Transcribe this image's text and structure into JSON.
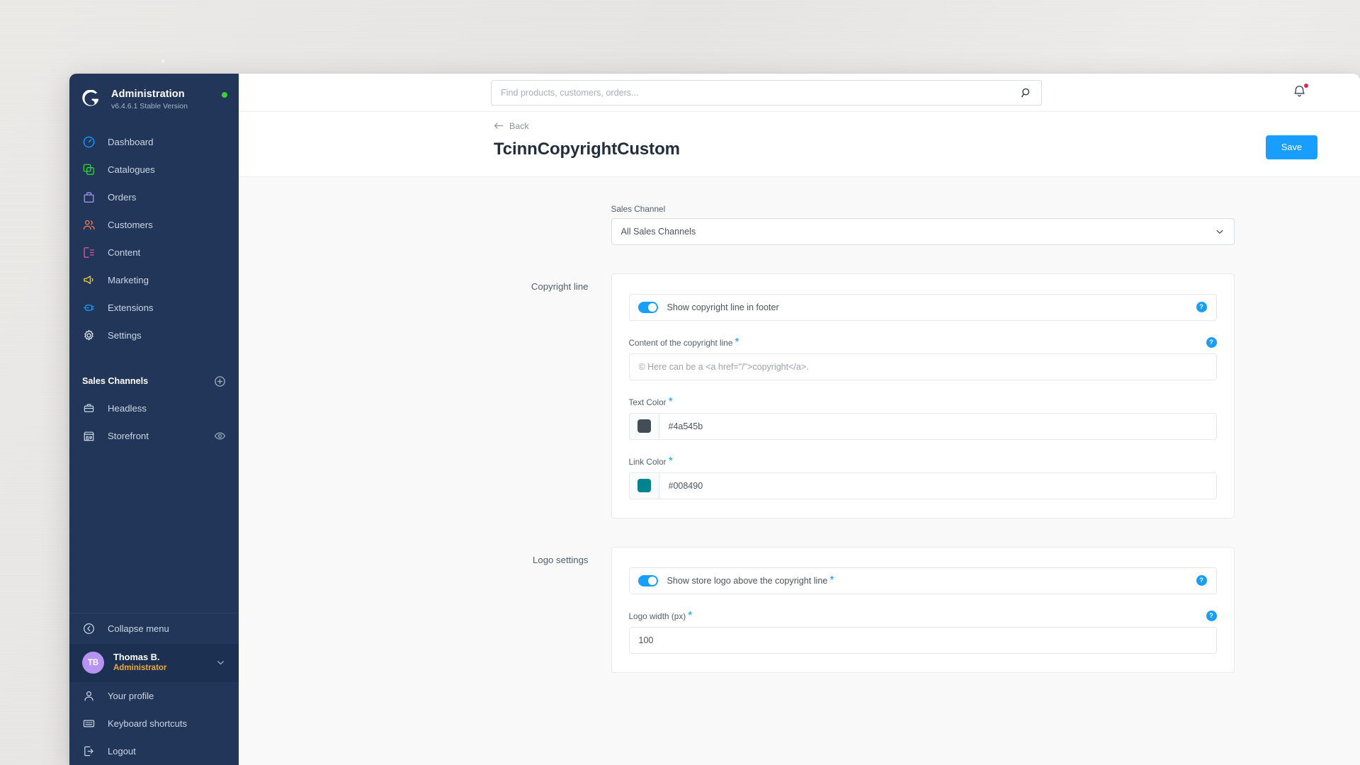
{
  "sidebar": {
    "brand": {
      "title": "Administration",
      "version": "v6.4.6.1 Stable Version",
      "logo_icon": "shopware-logo-icon",
      "status_icon": "status-online-dot"
    },
    "nav": [
      {
        "label": "Dashboard",
        "icon": "dashboard-icon",
        "color": "#189eff"
      },
      {
        "label": "Catalogues",
        "icon": "catalogues-icon",
        "color": "#37d039"
      },
      {
        "label": "Orders",
        "icon": "orders-icon",
        "color": "#a092f0"
      },
      {
        "label": "Customers",
        "icon": "customers-icon",
        "color": "#ee7b4f"
      },
      {
        "label": "Content",
        "icon": "content-icon",
        "color": "#e052a0"
      },
      {
        "label": "Marketing",
        "icon": "marketing-icon",
        "color": "#f0d124"
      },
      {
        "label": "Extensions",
        "icon": "extensions-icon",
        "color": "#189eff"
      },
      {
        "label": "Settings",
        "icon": "settings-gear-icon",
        "color": "#d8dde3"
      }
    ],
    "sales_channels": {
      "title": "Sales Channels",
      "add_icon": "plus-circle-icon",
      "items": [
        {
          "label": "Headless",
          "icon": "headless-icon"
        },
        {
          "label": "Storefront",
          "icon": "storefront-icon",
          "trailing_icon": "eye-icon"
        }
      ]
    },
    "collapse": {
      "label": "Collapse menu",
      "icon": "collapse-chevron-icon"
    },
    "user": {
      "initials": "TB",
      "name": "Thomas B.",
      "role": "Administrator",
      "chevron_icon": "chevron-down-icon"
    },
    "user_menu": [
      {
        "label": "Your profile",
        "icon": "user-icon"
      },
      {
        "label": "Keyboard shortcuts",
        "icon": "keyboard-icon"
      },
      {
        "label": "Logout",
        "icon": "logout-icon"
      }
    ]
  },
  "topbar": {
    "search": {
      "placeholder": "Find products, customers, orders...",
      "value": "",
      "icon": "search-icon"
    },
    "notifications": {
      "icon": "bell-icon",
      "has_unread": true
    }
  },
  "page": {
    "back_label": "Back",
    "back_icon": "arrow-left-icon",
    "title": "TcinnCopyrightCustom",
    "save_label": "Save"
  },
  "form": {
    "sales_channel": {
      "label": "Sales Channel",
      "value": "All Sales Channels",
      "chevron_icon": "chevron-down-icon"
    },
    "copyright_line": {
      "section_label": "Copyright line",
      "toggle": {
        "label": "Show copyright line in footer",
        "state": "on",
        "help_icon": "help-circle-icon",
        "help_glyph": "?"
      },
      "content": {
        "label": "Content of the copyright line",
        "required_mark": "*",
        "placeholder": "© Here can be a <a href=\"/\">copyright</a>.",
        "value": "",
        "help_glyph": "?"
      },
      "text_color": {
        "label": "Text Color",
        "required_mark": "*",
        "value": "#4a545b",
        "swatch": "#434d55"
      },
      "link_color": {
        "label": "Link Color",
        "required_mark": "*",
        "value": "#008490",
        "swatch": "#008490"
      }
    },
    "logo_settings": {
      "section_label": "Logo settings",
      "toggle": {
        "label": "Show store logo above the copyright line",
        "required_mark": "*",
        "state": "on",
        "help_glyph": "?"
      },
      "logo_width": {
        "label": "Logo width (px)",
        "required_mark": "*",
        "value": "100",
        "help_glyph": "?"
      }
    }
  },
  "colors": {
    "accent": "#189eff",
    "sidebar_bg": "#22365a",
    "save_button": "#189eff",
    "notification_dot": "#de294c",
    "avatar_bg": "#b794f4",
    "role_text": "#f0a93b"
  }
}
